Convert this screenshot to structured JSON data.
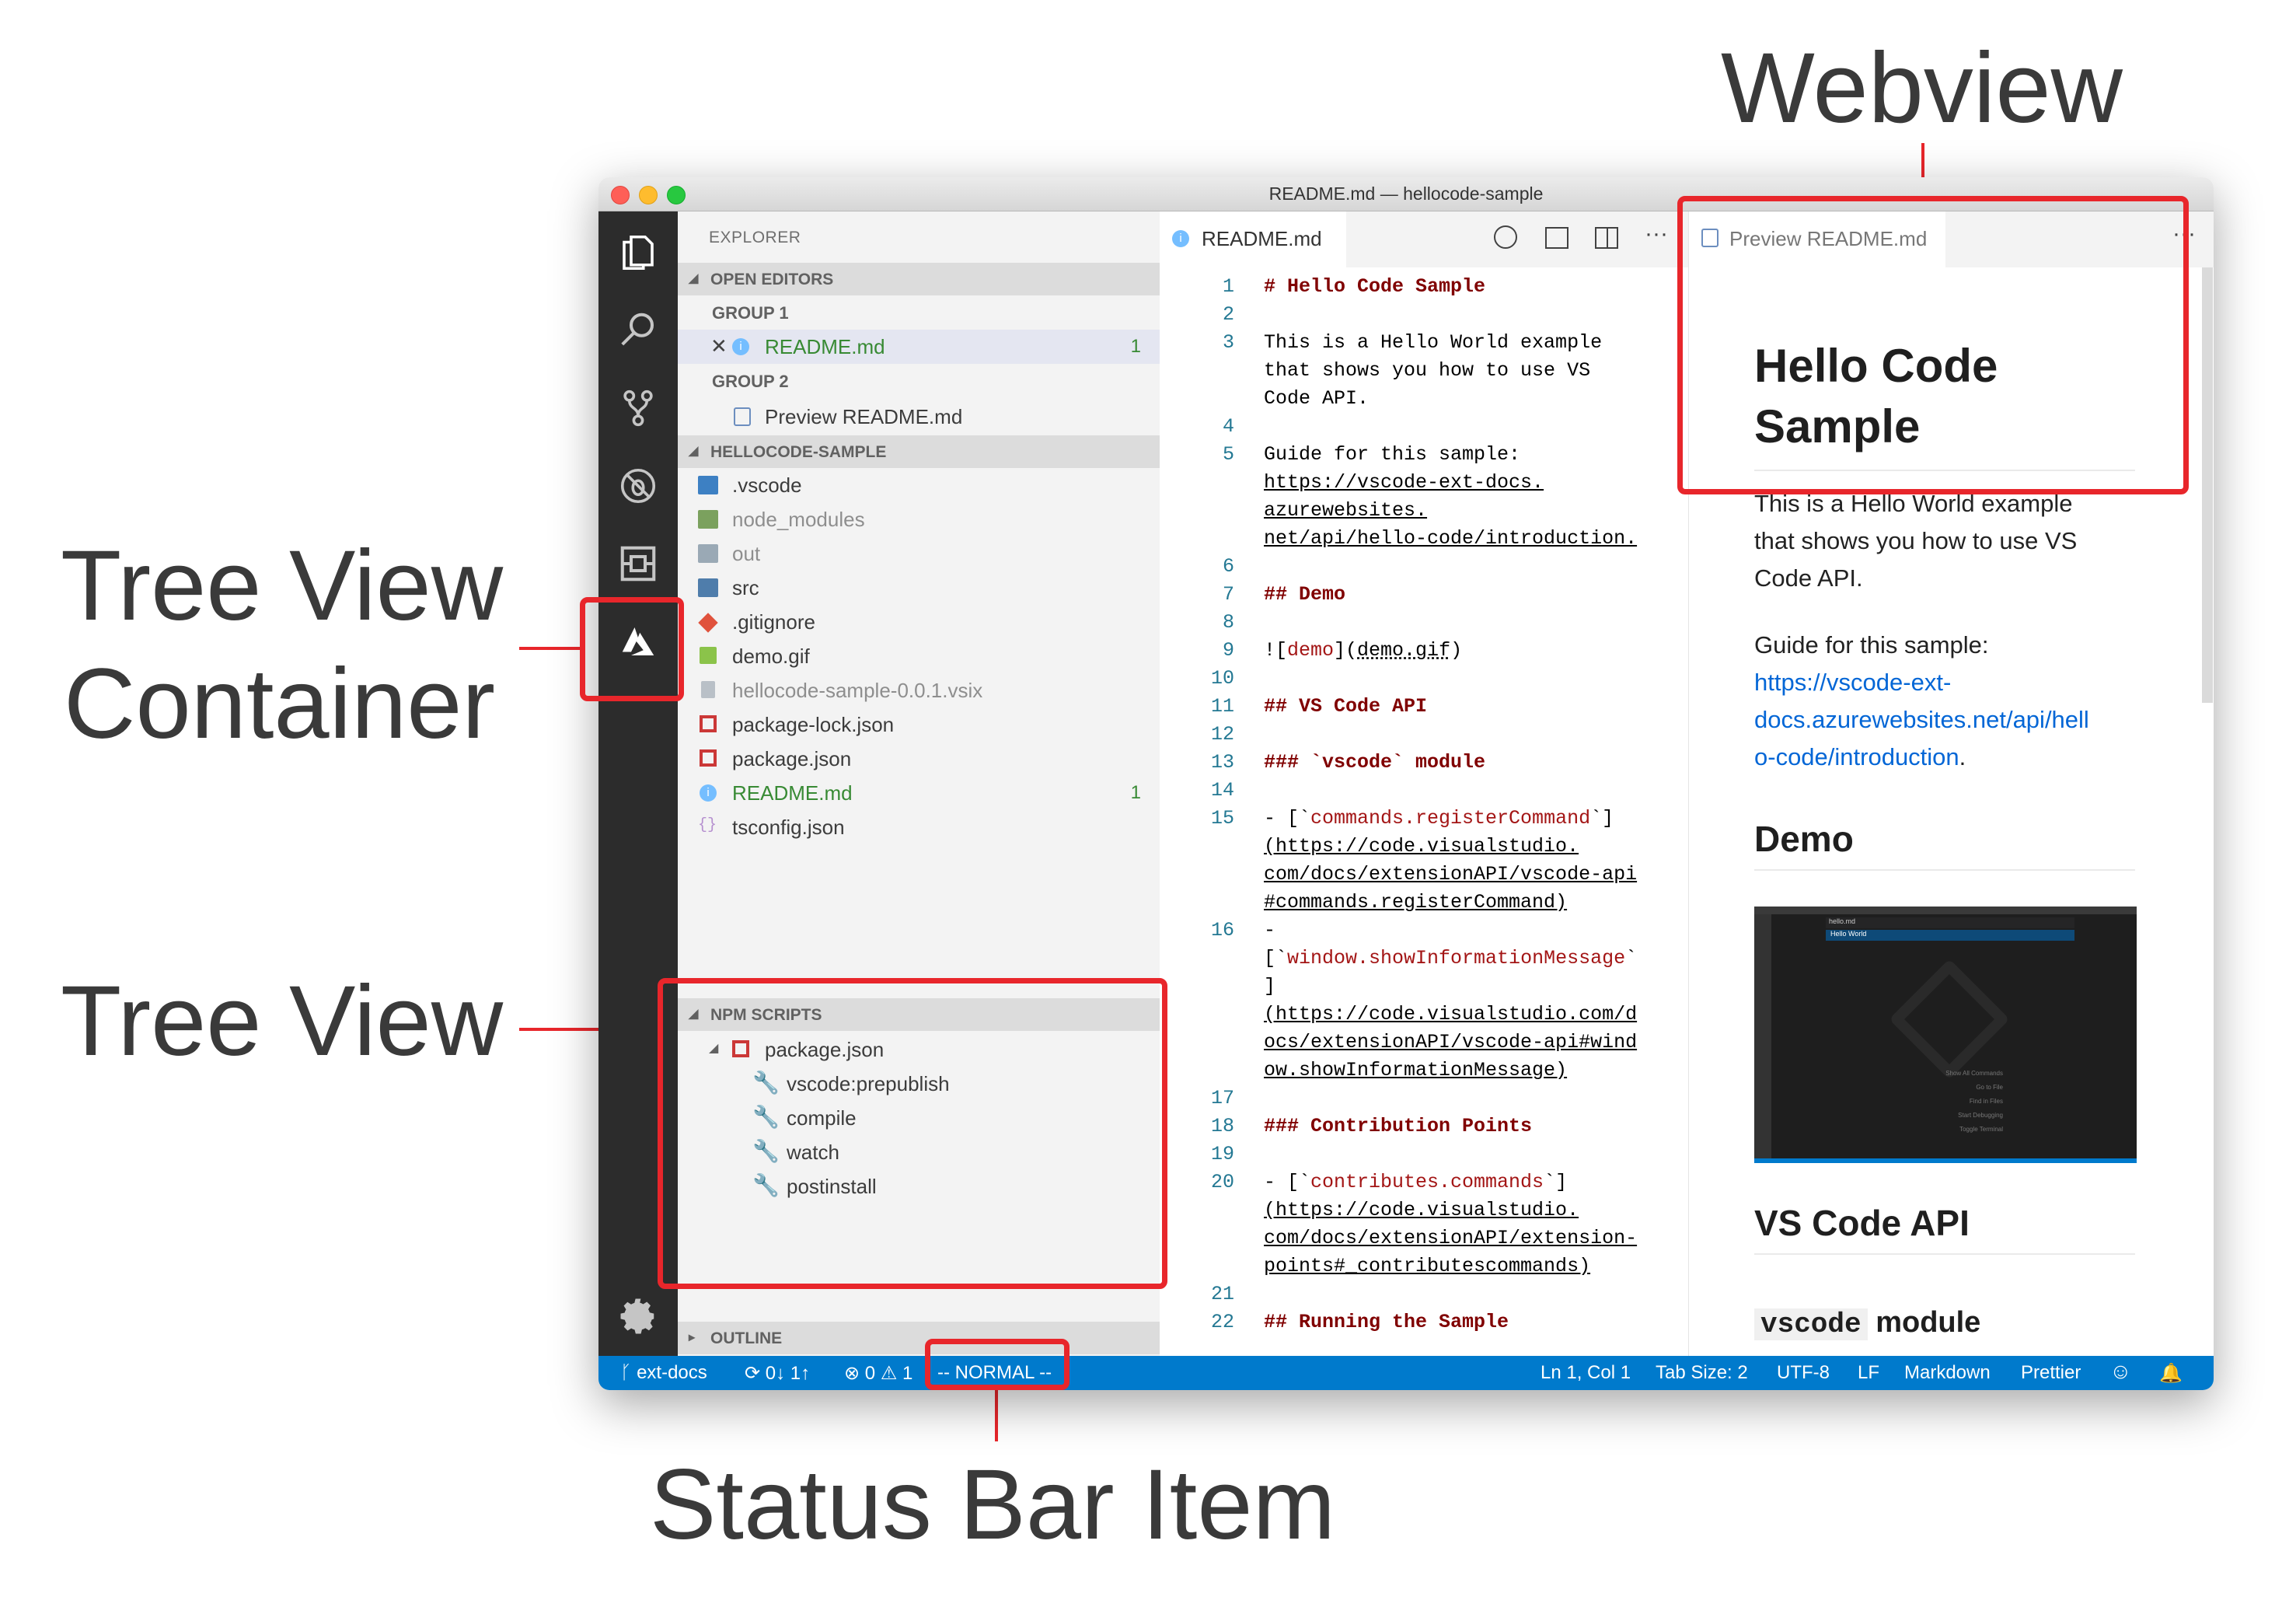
{
  "callouts": {
    "webview": "Webview",
    "tree_view_container_1": "Tree View",
    "tree_view_container_2": "Container",
    "tree_view": "Tree View",
    "status_bar_item": "Status Bar Item"
  },
  "window": {
    "title": "README.md — hellocode-sample"
  },
  "activity_bar": {
    "icons": [
      "files-icon",
      "search-icon",
      "source-control-icon",
      "debug-icon",
      "extensions-icon",
      "azure-icon",
      "settings-gear-icon"
    ]
  },
  "sidebar": {
    "header": "EXPLORER",
    "open_editors": {
      "label": "OPEN EDITORS",
      "group1": "GROUP 1",
      "group1_file": "README.md",
      "group1_badge": "1",
      "group2": "GROUP 2",
      "group2_file": "Preview README.md"
    },
    "project": {
      "label": "HELLOCODE-SAMPLE",
      "files": [
        ".vscode",
        "node_modules",
        "out",
        "src",
        ".gitignore",
        "demo.gif",
        "hellocode-sample-0.0.1.vsix",
        "package-lock.json",
        "package.json",
        "README.md",
        "tsconfig.json"
      ],
      "readme_badge": "1"
    },
    "npm_scripts": {
      "label": "NPM SCRIPTS",
      "package": "package.json",
      "scripts": [
        "vscode:prepublish",
        "compile",
        "watch",
        "postinstall"
      ]
    },
    "outline": {
      "label": "OUTLINE"
    }
  },
  "editor": {
    "tab_label": "README.md",
    "line_numbers": [
      "1",
      "2",
      "3",
      "4",
      "5",
      "6",
      "7",
      "8",
      "9",
      "10",
      "11",
      "12",
      "13",
      "14",
      "15",
      "16",
      "17",
      "18",
      "19",
      "20",
      "21",
      "22"
    ],
    "lines": {
      "l1": "# Hello Code Sample",
      "l3a": "This is a Hello World example",
      "l3b": "that shows you how to use VS",
      "l3c": "Code API.",
      "l5a": "Guide for this sample:",
      "l5b": "https://vscode-ext-docs.",
      "l5c": "azurewebsites.",
      "l5d": "net/api/hello-code/introduction.",
      "l7": "## Demo",
      "l9a": "![",
      "l9b": "demo",
      "l9c": "](",
      "l9d": "demo.gif",
      "l9e": ")",
      "l11": "## VS Code API",
      "l13": "### `vscode` module",
      "l15a": "- [`",
      "l15b": "commands.registerCommand",
      "l15c": "`]",
      "l15d": "(https://code.visualstudio.",
      "l15e": "com/docs/extensionAPI/vscode-api",
      "l15f": "#commands.registerCommand)",
      "l16a": "-",
      "l16b": "[`",
      "l16c": "window.showInformationMessage",
      "l16d": "`",
      "l16e": "]",
      "l16f": "(https://code.visualstudio.com/d",
      "l16g": "ocs/extensionAPI/vscode-api#wind",
      "l16h": "ow.showInformationMessage)",
      "l18": "### Contribution Points",
      "l20a": "- [`",
      "l20b": "contributes.commands",
      "l20c": "`]",
      "l20d": "(https://code.visualstudio.",
      "l20e": "com/docs/extensionAPI/extension-",
      "l20f": "points#_contributescommands)",
      "l22": "## Running the Sample"
    }
  },
  "preview": {
    "tab_label": "Preview README.md",
    "h1": "Hello Code Sample",
    "h1_line1": "Hello Code",
    "h1_line2": "Sample",
    "p1a": "This is a Hello World example",
    "p1b": "that shows you how to use VS",
    "p1c": "Code API.",
    "p2": "Guide for this sample:",
    "link_a": "https://vscode-ext-",
    "link_b": "docs.azurewebsites.net/api/hell",
    "link_c": "o-code/introduction",
    "link_end": ".",
    "h2_demo": "Demo",
    "h2_api": "VS Code API",
    "h3_module_code": "vscode",
    "h3_module_text": "module",
    "demo_image": {
      "header_text": "hello.md",
      "welcome": "Hello World",
      "menu": [
        "Show All Commands",
        "Go to File",
        "Find in Files",
        "Start Debugging",
        "Toggle Terminal"
      ]
    }
  },
  "status_bar": {
    "branch": "ext-docs",
    "sync": "0↓ 1↑",
    "errors": "0",
    "warnings": "1",
    "mode": "-- NORMAL --",
    "position": "Ln 1, Col 1",
    "tab_size": "Tab Size: 2",
    "encoding": "UTF-8",
    "eol": "LF",
    "language": "Markdown",
    "formatter": "Prettier"
  },
  "colors": {
    "accent": "#007acc",
    "highlight": "#e8262b",
    "activity_bar": "#2c2c2c",
    "heading_code": "#800000",
    "link": "#0366d6",
    "modified_green": "#388a34"
  }
}
